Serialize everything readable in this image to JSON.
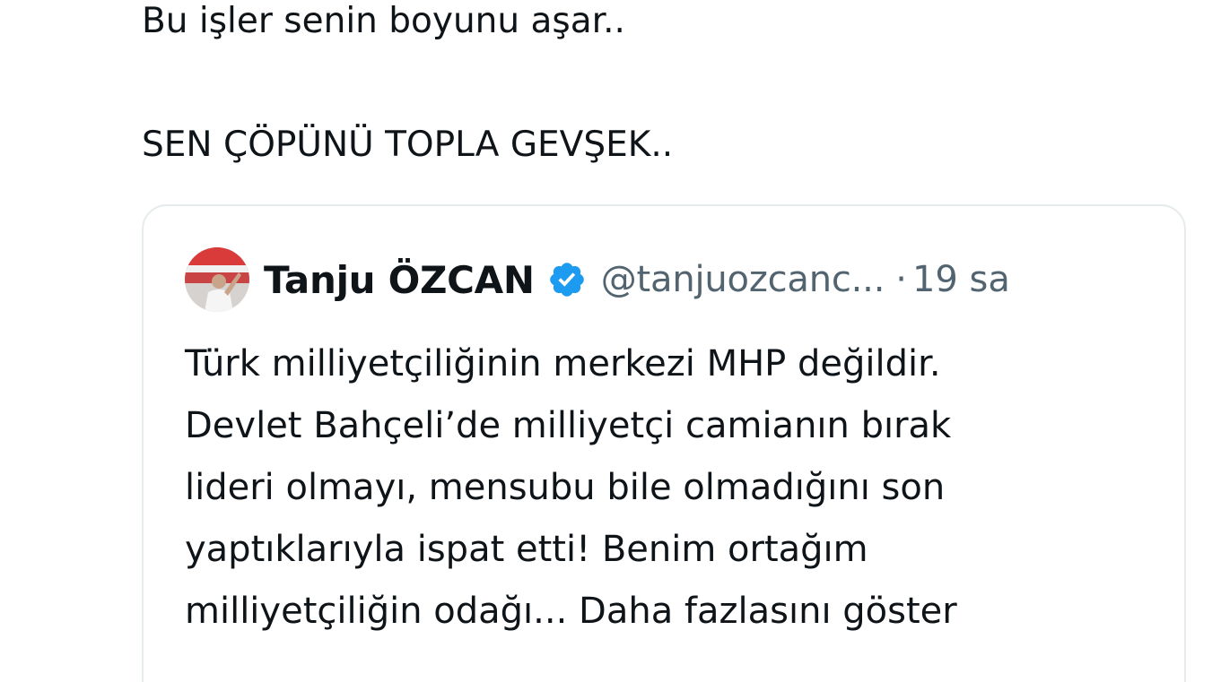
{
  "tweet": {
    "line1": "Bu işler senin boyunu aşar..",
    "line2": "SEN ÇÖPÜNÜ TOPLA GEVŞEK.."
  },
  "quoted_tweet": {
    "author_name": "Tanju ÖZCAN",
    "handle": "@tanjuozcanc...",
    "separator": "·",
    "timestamp": "19 sa",
    "verified_icon": "verified-badge-icon",
    "lines": [
      "Türk milliyetçiliğinin merkezi MHP değildir.",
      "Devlet Bahçeli’de milliyetçi camianın bırak",
      "lideri olmayı, mensubu bile olmadığını son",
      "yaptıklarıyla ispat etti! Benim ortağım",
      "milliyetçiliğin odağı..."
    ],
    "show_more": "Daha fazlasını göster"
  },
  "colors": {
    "text": "#0f1419",
    "muted": "#536471",
    "verified": "#1d9bf0",
    "border": "#e6ebee"
  }
}
